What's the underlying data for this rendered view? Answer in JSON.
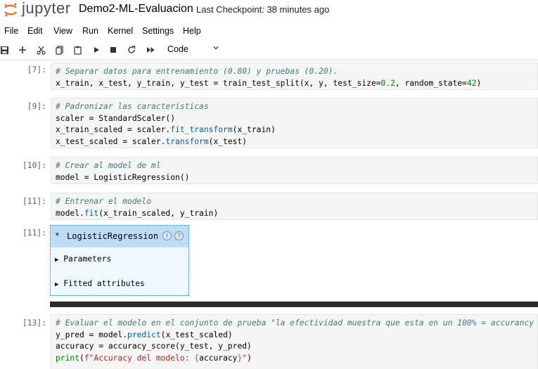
{
  "header": {
    "logo_text": "jupyter",
    "notebook_title": "Demo2-ML-Evaluacion",
    "checkpoint": "Last Checkpoint: 38 minutes ago"
  },
  "menu": [
    "File",
    "Edit",
    "View",
    "Run",
    "Kernel",
    "Settings",
    "Help"
  ],
  "toolbar": {
    "icons": [
      "save-icon",
      "add-cell-icon",
      "cut-icon",
      "copy-icon",
      "paste-icon",
      "run-icon",
      "stop-icon",
      "restart-icon",
      "run-all-icon"
    ],
    "cell_type": "Code"
  },
  "cells": [
    {
      "prompt": "[7]:",
      "lines": [
        "# Separar datos para entrenamiento (0.80) y pruebas (0.20).",
        "x_train, x_test, y_train, y_test = train_test_split(x, y, test_size=0.2, random_state=42)"
      ]
    },
    {
      "prompt": "[9]:",
      "lines": [
        "# Padronizar las características",
        "scaler = StandardScaler()",
        "x_train_scaled = scaler.fit_transform(x_train)",
        "x_test_scaled = scaler.transform(x_test)"
      ]
    },
    {
      "prompt": "[10]:",
      "lines": [
        "# Crear al model de ml",
        "model = LogisticRegression()"
      ]
    },
    {
      "prompt": "[11]:",
      "lines": [
        "# Entrenar el modelo",
        "model.fit(x_train_scaled, y_train)"
      ]
    },
    {
      "prompt": "[13]:",
      "lines": [
        "# Evaluar el modelo en el conjunto de prueba \"la efectividad muestra que esta en un 100% = accurancy 1.0",
        "y_pred = model.predict(x_test_scaled)",
        "accuracy = accuracy_score(y_test, y_pred)",
        "print(f\"Accuracy del modelo: {accuracy}\")"
      ]
    }
  ],
  "output": {
    "prompt": "[11]:",
    "title": "LogisticRegression",
    "info_icon_label": "i",
    "help_icon_label": "?",
    "sections": [
      "Parameters",
      "Fitted attributes"
    ]
  }
}
